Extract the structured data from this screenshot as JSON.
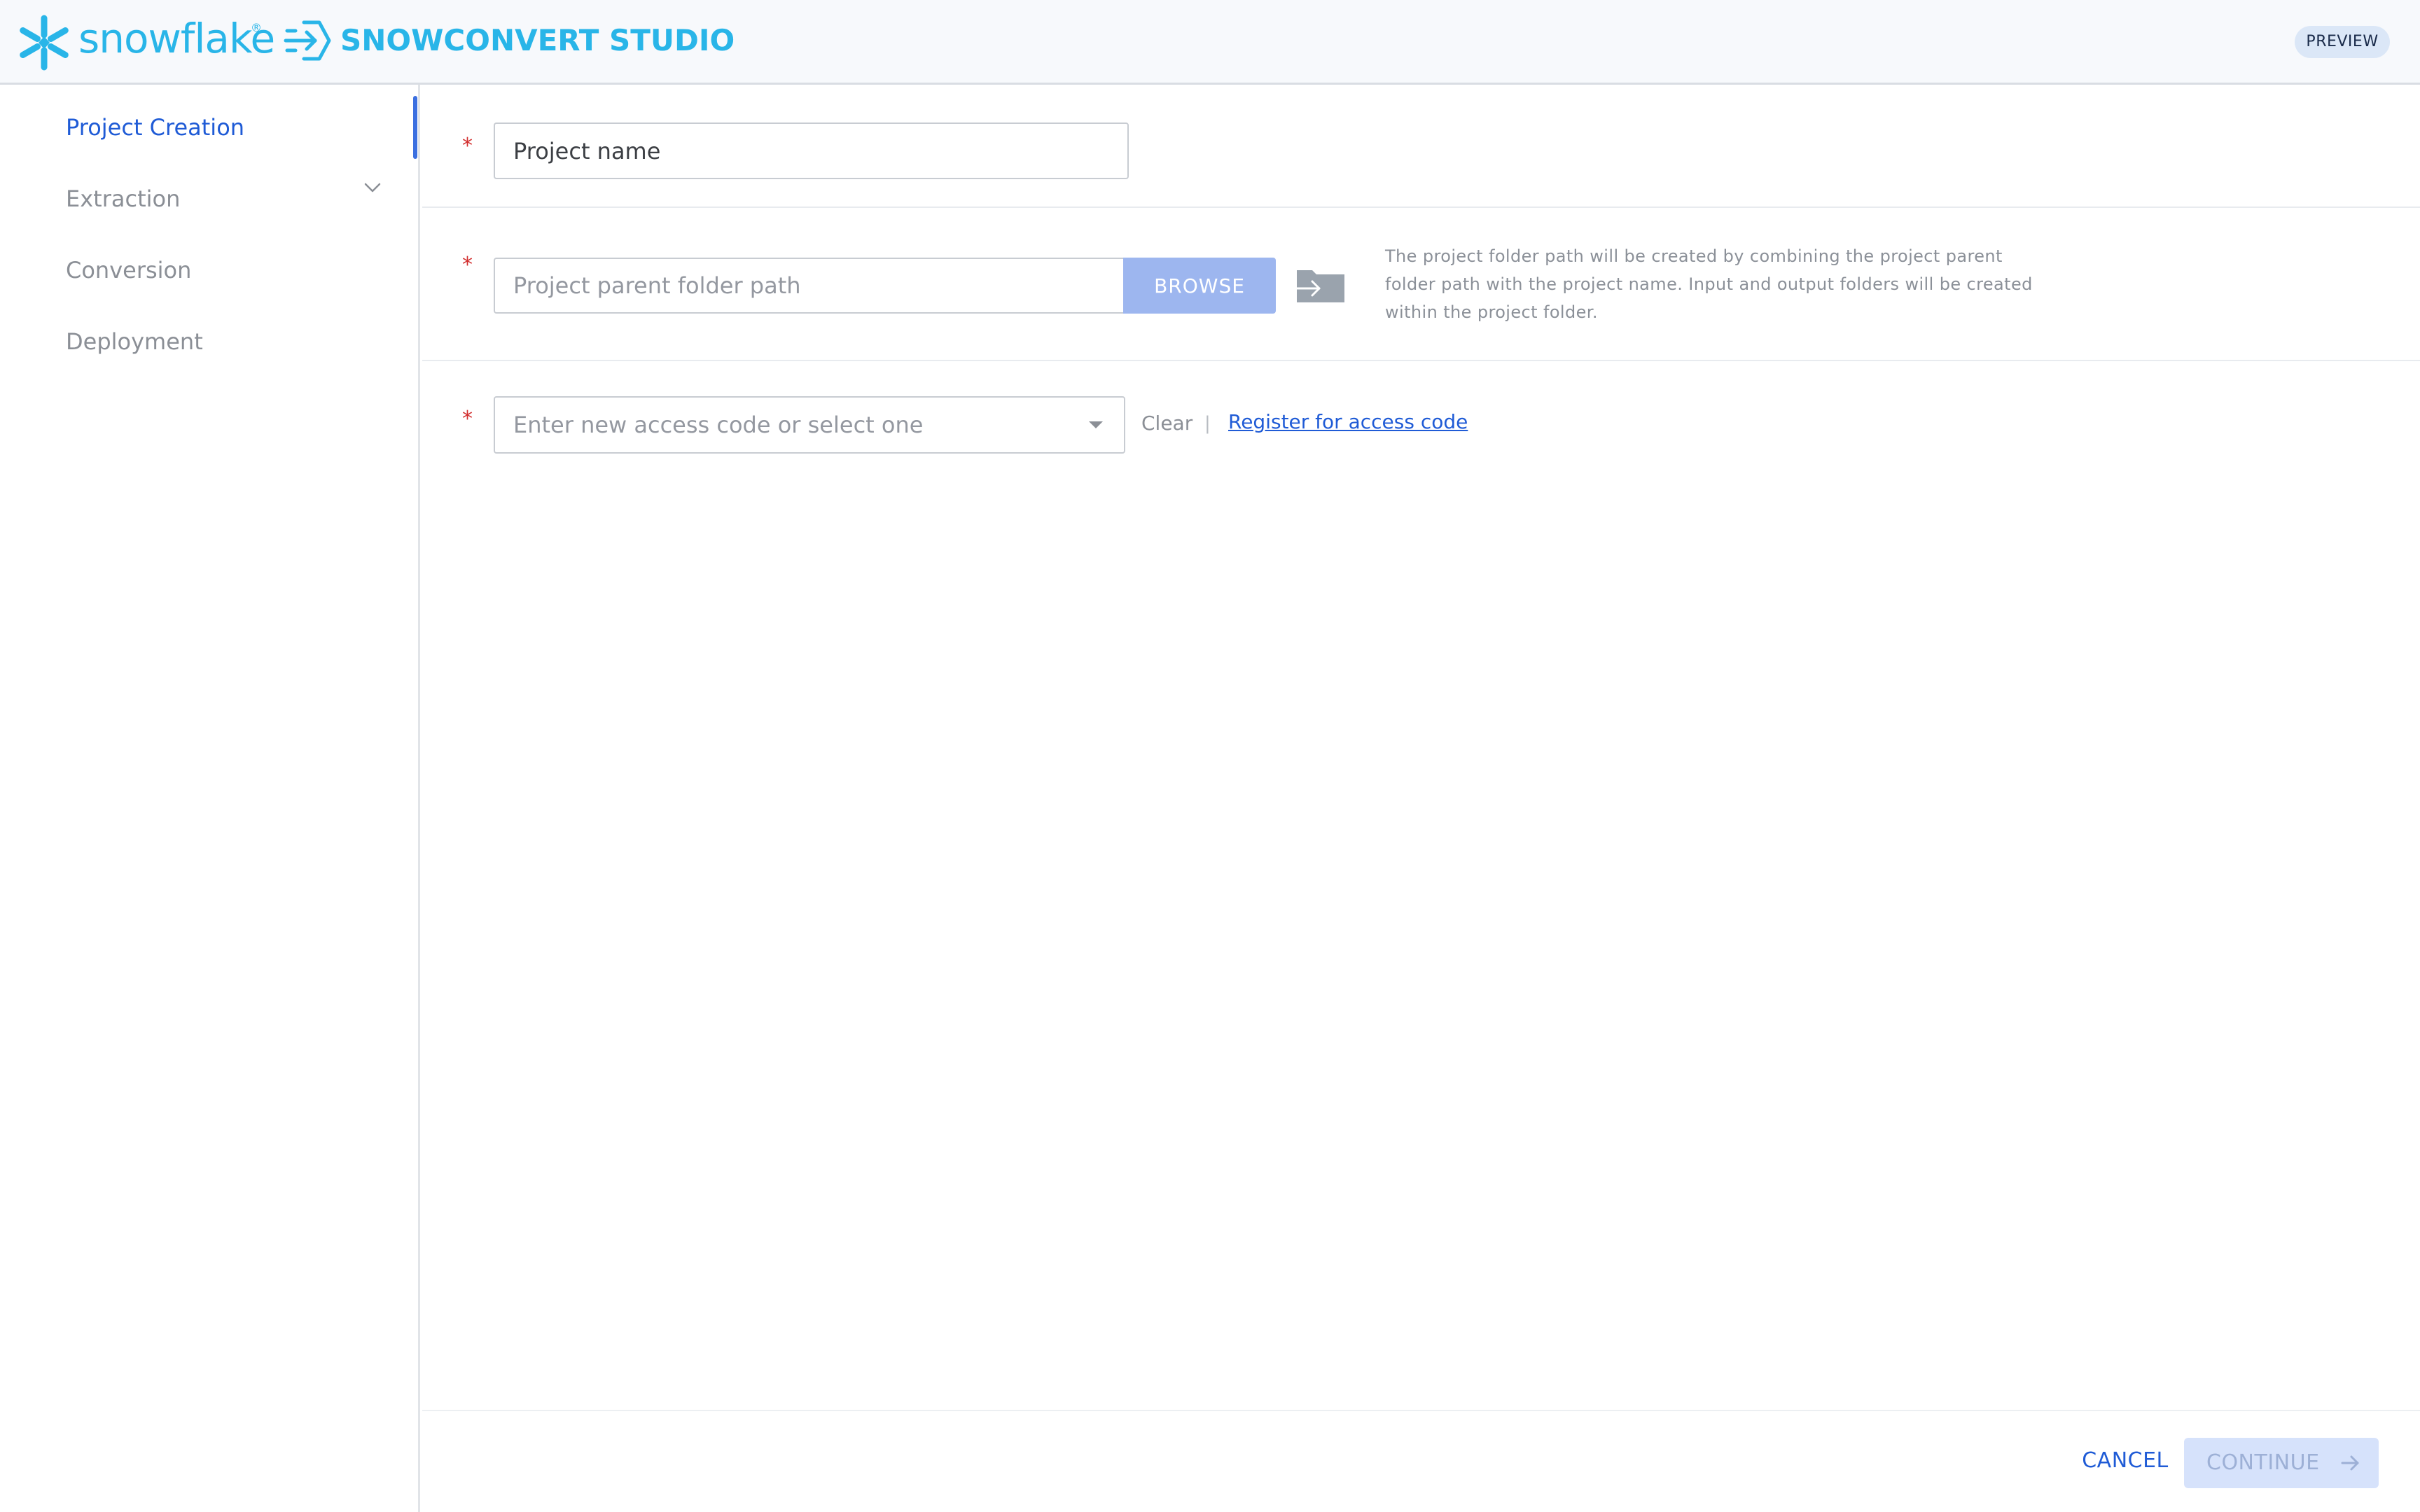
{
  "header": {
    "brand_name": "snowflake",
    "brand_registered": "®",
    "product_name": "SNOWCONVERT STUDIO",
    "badge": "PREVIEW",
    "brand_color": "#29b5e8",
    "icons": [
      "snowflake-logo-icon",
      "snowconvert-arrow-icon"
    ]
  },
  "sidebar": {
    "items": [
      {
        "label": "Project Creation",
        "active": true
      },
      {
        "label": "Extraction",
        "active": false
      },
      {
        "label": "Conversion",
        "active": false,
        "expandable": true
      },
      {
        "label": "Deployment",
        "active": false
      }
    ]
  },
  "form": {
    "project_name": {
      "required_mark": "*",
      "placeholder": "Project name",
      "value": ""
    },
    "parent_folder": {
      "required_mark": "*",
      "placeholder": "Project parent folder path",
      "value": "",
      "browse_label": "BROWSE",
      "help_text": "The project folder path will be created by combining the project parent folder path with the project name. Input and output folders will be created within the project folder."
    },
    "access_code": {
      "required_mark": "*",
      "placeholder": "Enter new access code or select one",
      "value": "",
      "clear_label": "Clear",
      "separator": "|",
      "register_label": "Register for access code"
    }
  },
  "footer": {
    "cancel_label": "CANCEL",
    "continue_label": "CONTINUE",
    "continue_enabled": false,
    "accent_color": "#1f5bd6"
  }
}
